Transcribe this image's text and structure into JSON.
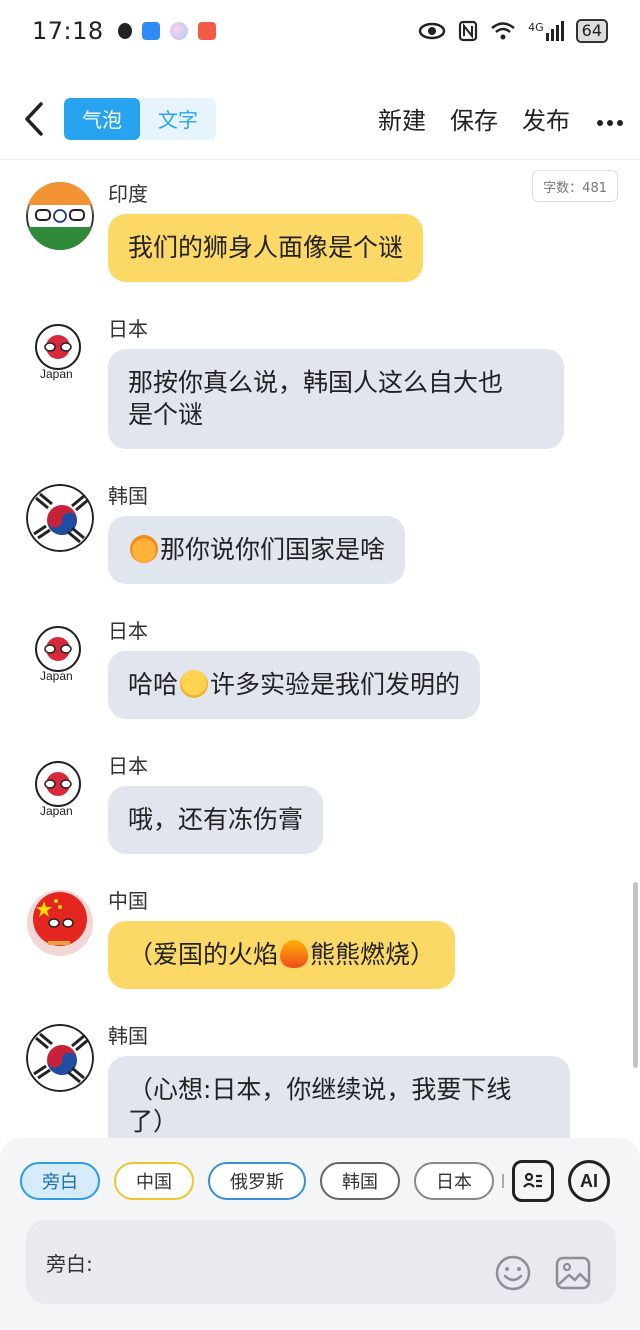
{
  "status_bar": {
    "time": "17:18",
    "network": "4G",
    "battery": "64"
  },
  "top_bar": {
    "mode_bubble": "气泡",
    "mode_text": "文字",
    "new_label": "新建",
    "save_label": "保存",
    "publish_label": "发布"
  },
  "char_count": "字数：481",
  "messages": [
    {
      "sender": "印度",
      "text": "我们的狮身人面像是个谜",
      "style": "yellow"
    },
    {
      "sender": "日本",
      "line1": "那按你真么说，韩国人这么自大也",
      "line2": "是个谜",
      "style": "gray",
      "avatar_text": "Japan"
    },
    {
      "sender": "韩国",
      "text": "那你说你们国家是啥",
      "style": "gray"
    },
    {
      "sender": "日本",
      "text_a": "哈哈",
      "text_b": "许多实验是我们发明的",
      "style": "gray",
      "avatar_text": "Japan"
    },
    {
      "sender": "日本",
      "text": "哦，还有冻伤膏",
      "style": "gray",
      "avatar_text": "Japan"
    },
    {
      "sender": "中国",
      "text_a": "（爱国的火焰",
      "text_b": "熊熊燃烧）",
      "style": "yellow"
    },
    {
      "sender": "韩国",
      "line1": "（心想:日本，你继续说，我要下线",
      "line2": "了）",
      "style": "gray"
    }
  ],
  "bottom": {
    "chips": [
      "旁白",
      "中国",
      "俄罗斯",
      "韩国",
      "日本"
    ],
    "ai_label": "AI",
    "input_prefix": "旁白:",
    "input_placeholder": ""
  },
  "colors": {
    "accent": "#27a3ef",
    "bubble_gray": "#e1e6ee",
    "bubble_yellow": "#fcd867"
  }
}
